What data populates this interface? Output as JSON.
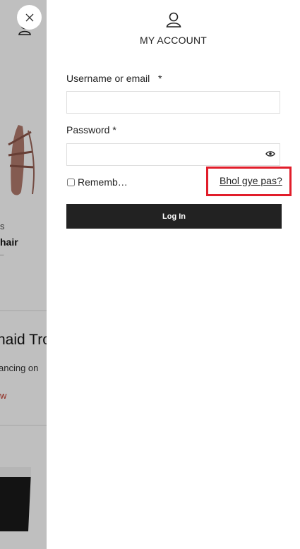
{
  "background": {
    "text_s": "s",
    "text_hair": "hair",
    "text_dash": "–",
    "heading": "naid Tro",
    "text_dancing": "ancing on",
    "link_w": "w"
  },
  "close_button": {
    "icon": "close-icon"
  },
  "account": {
    "icon": "user-icon",
    "title": "MY ACCOUNT"
  },
  "form": {
    "username_label": "Username or email",
    "username_required": "*",
    "username_value": "",
    "password_label": "Password",
    "password_required": "*",
    "password_value": "",
    "password_toggle_icon": "eye-icon",
    "remember_label": "Rememb…",
    "remember_checked": false,
    "forgot_link": "Bhol gye pas?",
    "forgot_highlight_color": "#e11d2a",
    "login_button": "Log In"
  },
  "colors": {
    "button_bg": "#222222",
    "overlay": "rgba(0,0,0,0.25)"
  }
}
